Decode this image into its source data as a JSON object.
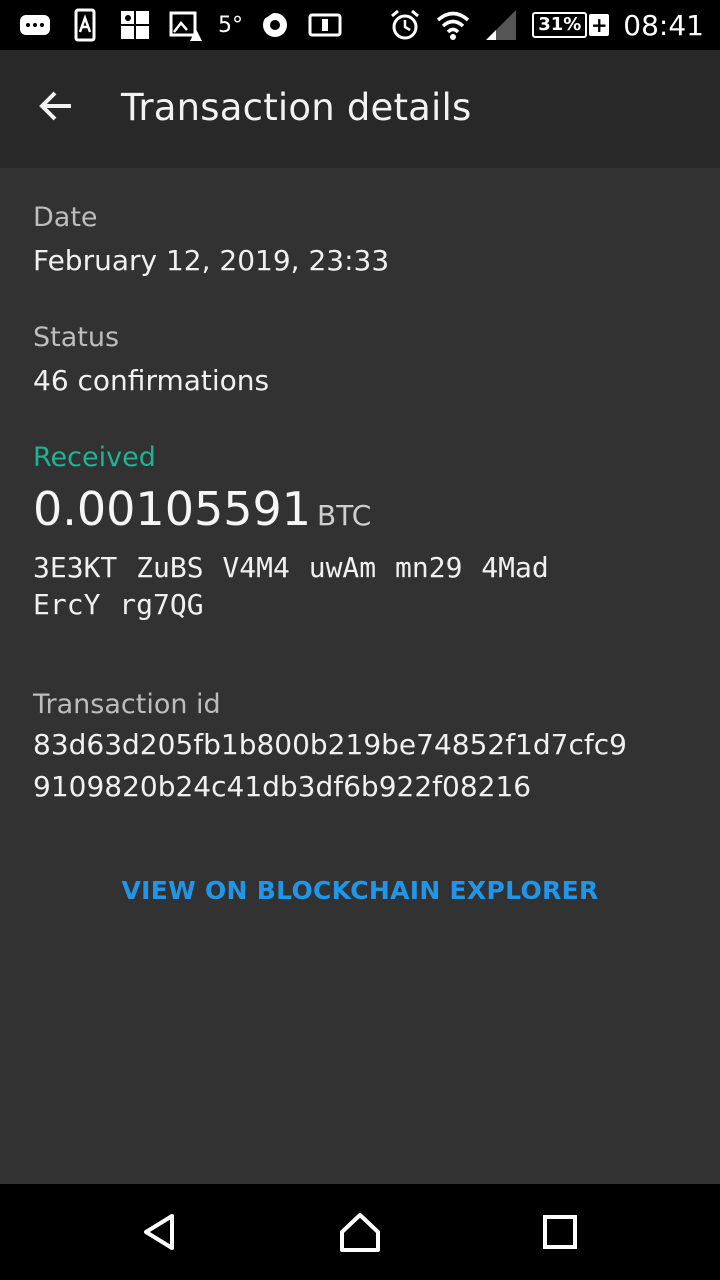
{
  "status_bar": {
    "temperature": "5°",
    "battery": "31%",
    "battery_plus": "+",
    "time": "08:41"
  },
  "app_bar": {
    "title": "Transaction details"
  },
  "details": {
    "date_label": "Date",
    "date_value": "February 12, 2019, 23:33",
    "status_label": "Status",
    "status_value": "46 confirmations",
    "received_label": "Received",
    "amount": "0.00105591",
    "unit": "BTC",
    "address_line1": "3E3KT ZuBS V4M4 uwAm mn29 4Mad",
    "address_line2": "ErcY rg7QG",
    "txid_label": "Transaction id",
    "txid_line1": "83d63d205fb1b800b219be74852f1d7cfc9",
    "txid_line2": "9109820b24c41db3df6b922f08216"
  },
  "actions": {
    "explorer_label": "VIEW ON BLOCKCHAIN EXPLORER"
  },
  "colors": {
    "background": "#323232",
    "app_bar": "#282828",
    "received": "#1db394",
    "link": "#2196e8"
  }
}
